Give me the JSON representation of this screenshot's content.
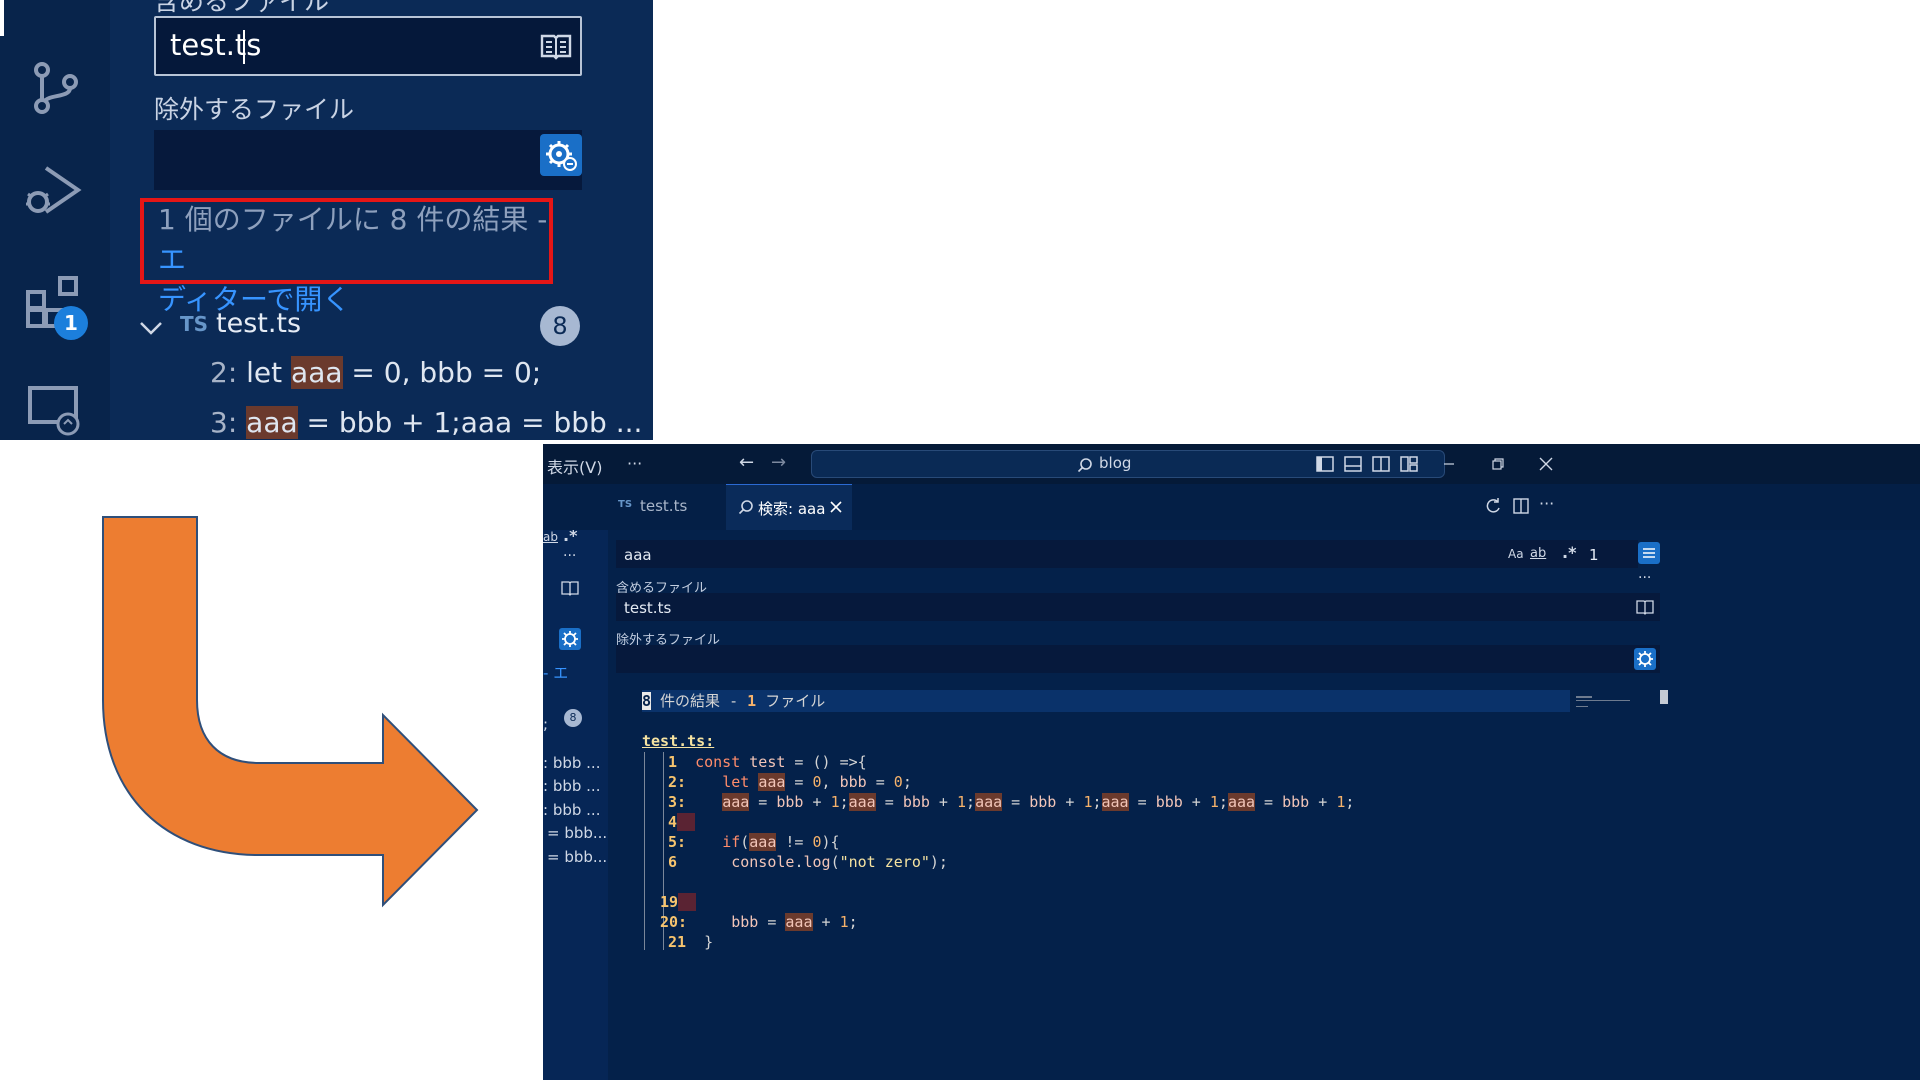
{
  "zoom_panel": {
    "include_label_partial": "含めるファイル",
    "include_value": "test.ts",
    "exclude_label": "除外するファイル",
    "exclude_value": "",
    "results_text": "1 個のファイルに 8 件の結果 - ",
    "results_link_part1": "エ",
    "results_link_part2": "ディターで開く",
    "file_badge": "TS",
    "file_name": "test.ts",
    "file_count": "8",
    "activity_badge": "1",
    "matches": [
      {
        "line": "2:",
        "pre": " let ",
        "hit": "aaa",
        "post": " = 0, bbb = 0;"
      },
      {
        "line": "3:",
        "pre": " ",
        "hit": "aaa",
        "post": " = bbb + 1;aaa = bbb ..."
      }
    ]
  },
  "window": {
    "menu_view": "表示(V)",
    "menu_more": "···",
    "nav_back": "←",
    "nav_forward": "→",
    "command_center": "blog",
    "tabs": [
      {
        "badge": "TS",
        "label": "test.ts",
        "active": false
      },
      {
        "label": "検索: aaa",
        "active": true
      }
    ],
    "left_strip": {
      "item_e": "エ",
      "count": "8",
      "snippets": [
        "bbb ...",
        "bbb ...",
        "bbb ...",
        "= bbb...",
        "= bbb..."
      ]
    },
    "search": {
      "query": "aaa",
      "opt_case": "Aa",
      "opt_word": "ab",
      "opt_regex": ".*",
      "context_lines": "1"
    },
    "include_label": "含めるファイル",
    "include_value": "test.ts",
    "exclude_label": "除外するファイル",
    "exclude_value": "",
    "more": "···",
    "results_header": {
      "count": "8",
      "mid": " 件の結果 - ",
      "files": "1",
      "tail": " ファイル"
    },
    "file_header": "test.ts:",
    "code_lines": [
      {
        "num": "1",
        "sep": "  ",
        "code": "const test = () =>{"
      },
      {
        "num": "2:",
        "sep": "  ",
        "code": "  let aaa = 0, bbb = 0;"
      },
      {
        "num": "3:",
        "sep": "  ",
        "code": "  aaa = bbb + 1;aaa = bbb + 1;aaa = bbb + 1;aaa = bbb + 1;aaa = bbb + 1;"
      },
      {
        "num": "4",
        "sep": "",
        "code": ""
      },
      {
        "num": "5:",
        "sep": "  ",
        "code": "  if(aaa != 0){"
      },
      {
        "num": "6",
        "sep": "  ",
        "code": "    console.log(\"not zero\");"
      },
      {
        "num": "",
        "sep": "",
        "code": ""
      },
      {
        "num": "19",
        "sep": "",
        "code": ""
      },
      {
        "num": "20:",
        "sep": "  ",
        "code": "  bbb = aaa + 1;"
      },
      {
        "num": "21",
        "sep": "  ",
        "code": "}"
      }
    ]
  },
  "colors": {
    "accent_blue": "#3794ff",
    "highlight_box": "#e51616",
    "arrow_fill": "#ed7d31",
    "arrow_stroke": "#2f4f7a",
    "match_bg": "#6b3a2d"
  }
}
